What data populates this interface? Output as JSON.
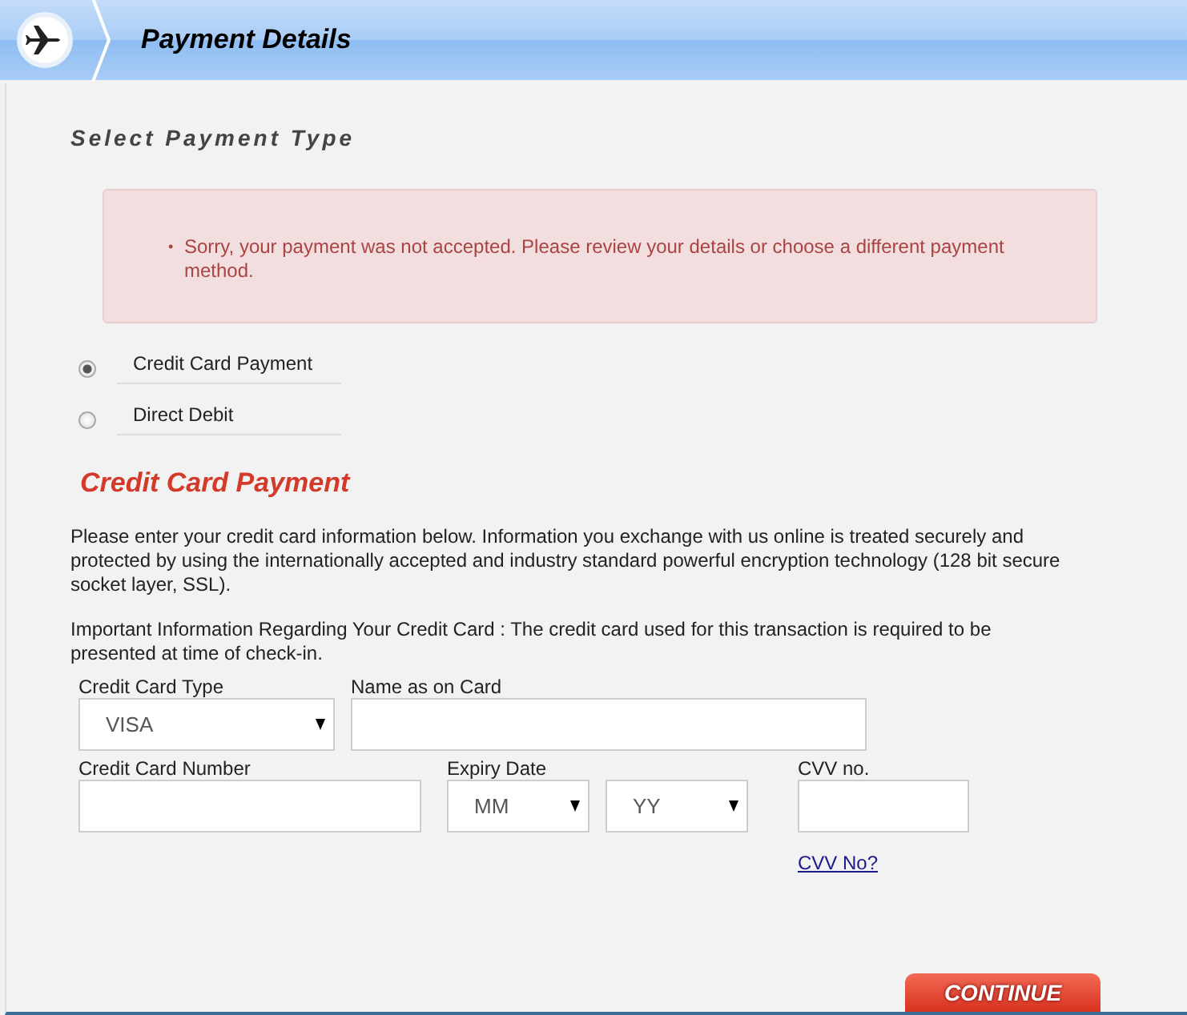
{
  "header": {
    "title": "Payment Details"
  },
  "section_title": "Select Payment Type",
  "alert": {
    "bullet": "•",
    "messages": [
      "Sorry, your payment was not accepted. Please review your details or choose a different payment method."
    ]
  },
  "payment_types": [
    {
      "label": "Credit Card Payment",
      "selected": true
    },
    {
      "label": "Direct Debit",
      "selected": false
    }
  ],
  "form_title": "Credit Card Payment",
  "paragraphs": [
    "Please enter your credit card information below. Information you exchange with us online is treated securely and protected by using the internationally accepted and industry standard powerful encryption technology (128 bit secure socket layer, SSL).",
    "Important Information Regarding Your Credit Card : The credit card used for this transaction is required to be presented at time of check-in."
  ],
  "fields": {
    "card_type": {
      "label": "Credit Card Type",
      "value": "VISA"
    },
    "name": {
      "label": "Name as on Card"
    },
    "number": {
      "label": "Credit Card Number"
    },
    "expiry": {
      "label": "Expiry Date",
      "month": "MM",
      "year": "YY"
    },
    "cvv": {
      "label": "CVV no.",
      "link": "CVV No?"
    }
  },
  "continue_button": "CONTINUE"
}
